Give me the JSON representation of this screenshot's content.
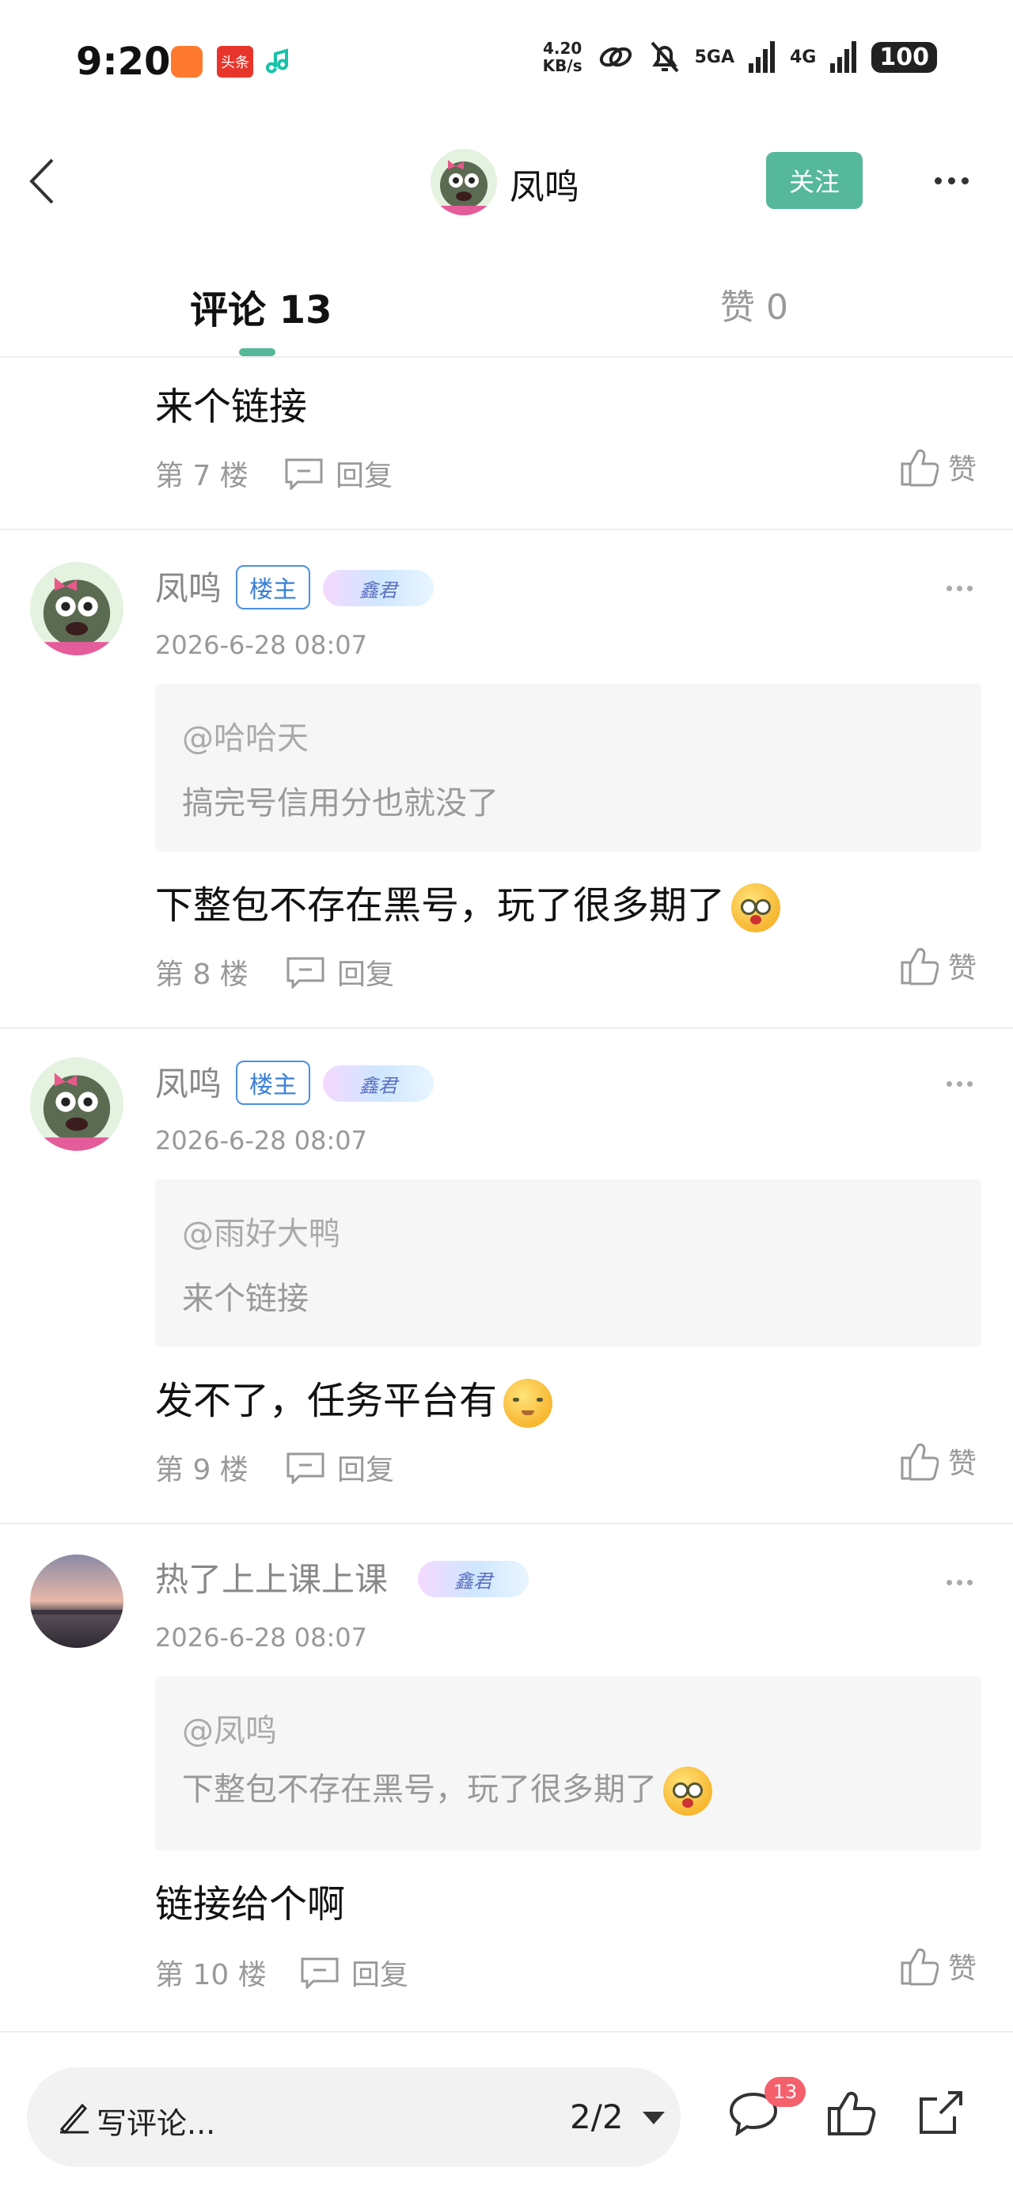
{
  "status_bar": {
    "time": "9:20",
    "app_icons": [
      "app-icon-orange",
      "toutiao-icon",
      "music-icon"
    ],
    "toutiao_label": "头条",
    "net_speed_value": "4.20",
    "net_speed_unit": "KB/s",
    "signal_1": "5GA",
    "signal_2": "4G",
    "battery": "100"
  },
  "nav": {
    "username": "凤鸣",
    "follow_label": "关注"
  },
  "tabs": {
    "comments": "评论 13",
    "likes": "赞 0"
  },
  "labels": {
    "reply": "回复",
    "like": "赞",
    "host_badge": "楼主",
    "level_badge": "鑫君"
  },
  "comments": [
    {
      "content": "来个链接",
      "floor": "第 7 楼"
    },
    {
      "username": "凤鸣",
      "is_host": true,
      "date": "2026-6-28 08:07",
      "quote_at": "@哈哈天",
      "quote_text": "搞完号信用分也就没了",
      "content": "下整包不存在黑号，玩了很多期了",
      "floor": "第 8 楼"
    },
    {
      "username": "凤鸣",
      "is_host": true,
      "date": "2026-6-28 08:07",
      "quote_at": "@雨好大鸭",
      "quote_text": "来个链接",
      "content": "发不了，任务平台有",
      "floor": "第 9 楼"
    },
    {
      "username": "热了上上课上课",
      "is_host": false,
      "date": "2026-6-28 08:07",
      "quote_at": "@凤鸣",
      "quote_text": "下整包不存在黑号，玩了很多期了",
      "content": "链接给个啊",
      "floor": "第 10 楼"
    }
  ],
  "bottom": {
    "input_placeholder": "写评论...",
    "page_indicator": "2/2",
    "comment_count": "13"
  },
  "colors": {
    "accent": "#55b89a",
    "host_badge": "#3a7fd8",
    "notification": "#f4606c"
  }
}
